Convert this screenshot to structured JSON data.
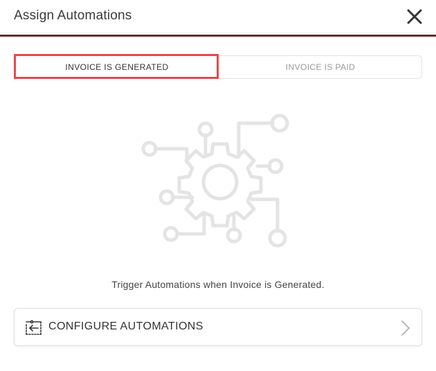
{
  "dialog": {
    "title": "Assign Automations",
    "close_icon": "close-icon",
    "accent_color": "#6b2a28"
  },
  "tabs": [
    {
      "label": "INVOICE IS GENERATED",
      "active": true
    },
    {
      "label": "INVOICE IS PAID",
      "active": false
    }
  ],
  "highlight_color": "#e5484d",
  "illustration_icon": "automation-gear-circuit-icon",
  "message": "Trigger Automations when Invoice is Generated.",
  "configure_button": {
    "label": "CONFIGURE AUTOMATIONS",
    "icon": "configure-automation-icon",
    "trailing_icon": "chevron-right-icon"
  }
}
